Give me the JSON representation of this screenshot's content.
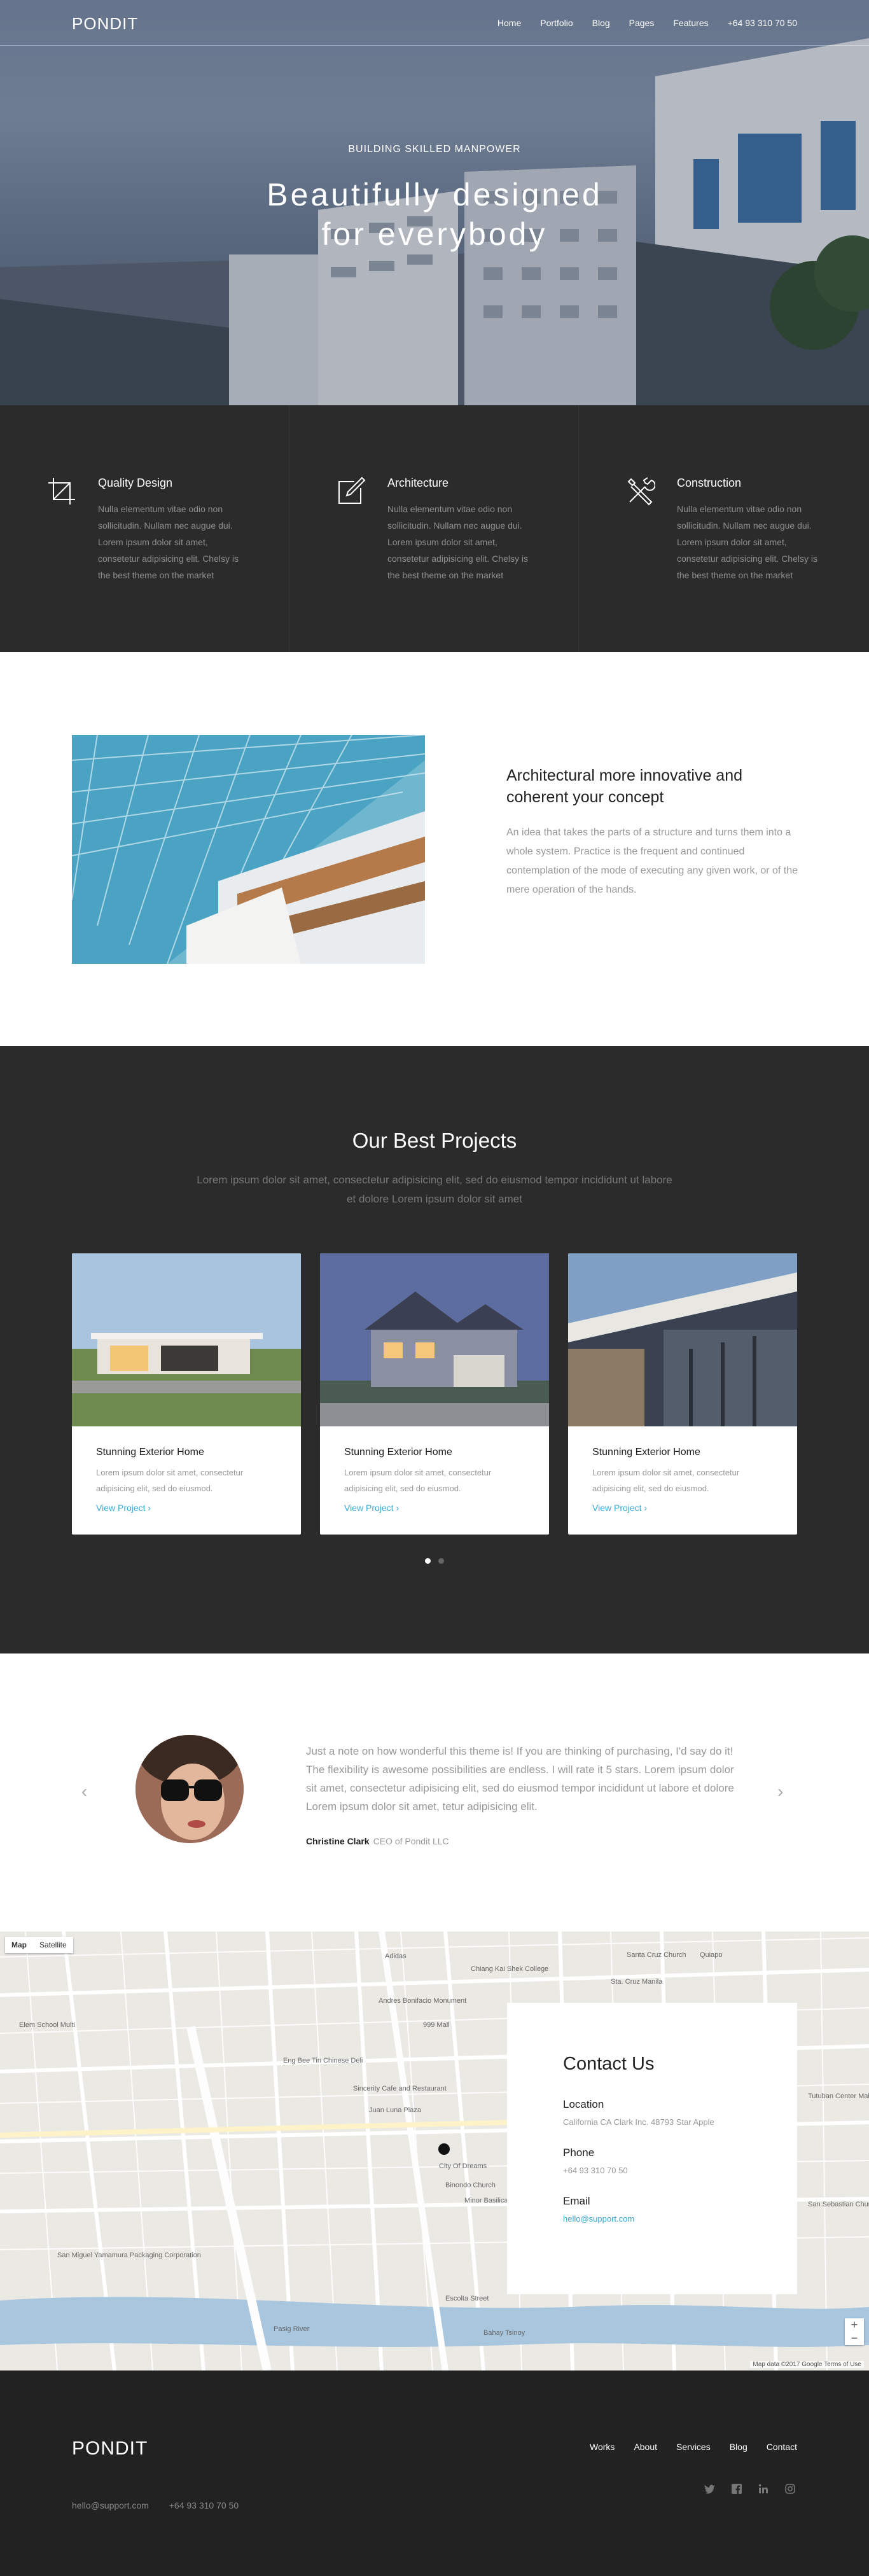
{
  "header": {
    "logo": "PONDIT",
    "menu": [
      "Home",
      "Portfolio",
      "Blog",
      "Pages",
      "Features",
      "+64 93 310 70 50"
    ]
  },
  "hero": {
    "kicker": "BUILDING SKILLED MANPOWER",
    "title_line1": "Beautifully designed",
    "title_line2": "for everybody"
  },
  "features": [
    {
      "icon": "crop-icon",
      "title": "Quality Design",
      "text": "Nulla elementum vitae odio non sollicitudin. Nullam nec augue dui. Lorem ipsum dolor sit amet, consetetur adipisicing elit. Chelsy is the best theme on the market"
    },
    {
      "icon": "edit-icon",
      "title": "Architecture",
      "text": "Nulla elementum vitae odio non sollicitudin. Nullam nec augue dui. Lorem ipsum dolor sit amet, consetetur adipisicing elit. Chelsy is the best theme on the market"
    },
    {
      "icon": "tools-icon",
      "title": "Construction",
      "text": "Nulla elementum vitae odio non sollicitudin. Nullam nec augue dui. Lorem ipsum dolor sit amet, consetetur adipisicing elit. Chelsy is the best theme on the market"
    }
  ],
  "about": {
    "title": "Architectural more innovative and coherent your concept",
    "text": "An idea that takes the parts of a structure and turns them into a whole system. Practice is the frequent and continued contemplation of the mode of executing any given work, or of the mere operation of the hands."
  },
  "projects": {
    "title": "Our Best Projects",
    "subtitle": "Lorem ipsum dolor sit amet, consectetur adipisicing elit, sed do eiusmod tempor incididunt ut labore et dolore Lorem ipsum dolor sit amet",
    "cards": [
      {
        "title": "Stunning Exterior Home",
        "text": "Lorem ipsum dolor sit amet, consectetur adipisicing elit, sed do eiusmod.",
        "link": "View Project ›"
      },
      {
        "title": "Stunning Exterior Home",
        "text": "Lorem ipsum dolor sit amet, consectetur adipisicing elit, sed do eiusmod.",
        "link": "View Project ›"
      },
      {
        "title": "Stunning Exterior Home",
        "text": "Lorem ipsum dolor sit amet, consectetur adipisicing elit, sed do eiusmod.",
        "link": "View Project ›"
      }
    ]
  },
  "testimonial": {
    "prev": "‹",
    "next": "›",
    "quote": "Just a note on how wonderful this theme is! If you are thinking of purchasing, I'd say do it! The flexibility is awesome possibilities are endless. I will rate it 5 stars. Lorem ipsum dolor sit amet, consectetur adipisicing elit, sed do eiusmod tempor incididunt ut labore et dolore Lorem ipsum dolor sit amet, tetur adipisicing elit.",
    "name": "Christine Clark",
    "role": "CEO of Pondit LLC"
  },
  "map": {
    "tab_map": "Map",
    "tab_satellite": "Satellite",
    "credit": "Map data ©2017 Google   Terms of Use",
    "zoom_in": "+",
    "zoom_out": "−",
    "labels": [
      "Adidas",
      "Chiang Kai Shek College",
      "Andres Bonifacio Monument",
      "999 Mall",
      "Eng Bee Tin Chinese Deli",
      "Sincerity Cafe and Restaurant",
      "Juan Luna Plaza",
      "City Of Dreams",
      "Binondo Church",
      "Minor Basilica of St. Lorenzo Ruiz",
      "Escolta Street",
      "Pasig River",
      "Sta. Cruz Manila",
      "Tutuban Center Mall",
      "San Miguel Yamamura Packaging Corporation",
      "Bahay Tsinoy",
      "Santa Cruz Church",
      "Quiapo",
      "San Sebastian Church",
      "Elem School Multi"
    ]
  },
  "contact": {
    "title": "Contact Us",
    "location_label": "Location",
    "location": "California CA Clark Inc. 48793 Star Apple",
    "phone_label": "Phone",
    "phone": "+64 93 310 70 50",
    "email_label": "Email",
    "email": "hello@support.com"
  },
  "footer": {
    "logo": "PONDIT",
    "menu": [
      "Works",
      "About",
      "Services",
      "Blog",
      "Contact"
    ],
    "social": [
      "twitter-icon",
      "facebook-icon",
      "linkedin-icon",
      "instagram-icon"
    ],
    "email": "hello@support.com",
    "phone": "+64 93 310 70 50"
  },
  "colors": {
    "accent": "#36a9d6",
    "dark": "#2b2b2b",
    "footer": "#222222"
  }
}
